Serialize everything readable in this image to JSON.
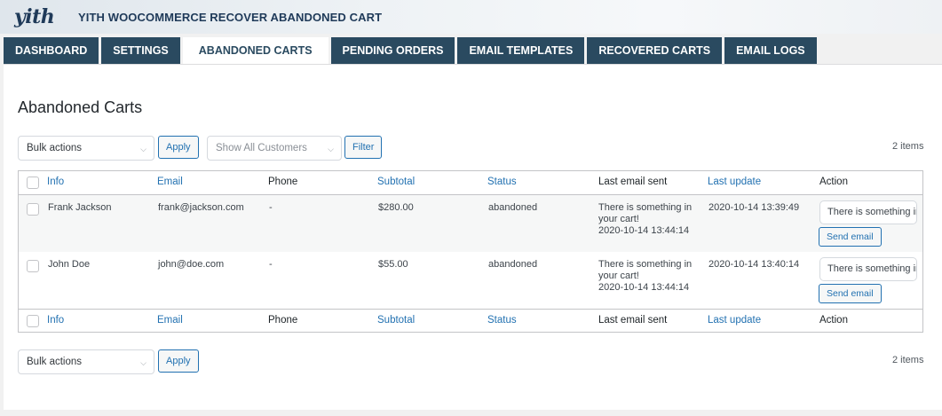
{
  "banner": {
    "logo": "yith",
    "title": "YITH WOOCOMMERCE RECOVER ABANDONED CART"
  },
  "tabs": [
    {
      "label": "DASHBOARD",
      "active": false
    },
    {
      "label": "SETTINGS",
      "active": false
    },
    {
      "label": "ABANDONED CARTS",
      "active": true
    },
    {
      "label": "PENDING ORDERS",
      "active": false
    },
    {
      "label": "EMAIL TEMPLATES",
      "active": false
    },
    {
      "label": "RECOVERED CARTS",
      "active": false
    },
    {
      "label": "EMAIL LOGS",
      "active": false
    }
  ],
  "page": {
    "title": "Abandoned Carts"
  },
  "top_controls": {
    "bulk_actions": "Bulk actions",
    "apply": "Apply",
    "customer_filter": "Show All Customers",
    "filter": "Filter",
    "items_count": "2 items"
  },
  "bottom_controls": {
    "bulk_actions": "Bulk actions",
    "apply": "Apply",
    "items_count": "2 items"
  },
  "table": {
    "columns": {
      "info": "Info",
      "email": "Email",
      "phone": "Phone",
      "subtotal": "Subtotal",
      "status": "Status",
      "last_email_sent": "Last email sent",
      "last_update": "Last update",
      "action": "Action"
    },
    "rows": [
      {
        "info": "Frank Jackson",
        "email": "frank@jackson.com",
        "phone": "-",
        "subtotal": "$280.00",
        "status": "abandoned",
        "last_email_line1": "There is something in",
        "last_email_line2": "your cart!",
        "last_email_date": "2020-10-14 13:44:14",
        "last_update": "2020-10-14 13:39:49",
        "action_text": "There is something in your cart!",
        "send_label": "Send email"
      },
      {
        "info": "John Doe",
        "email": "john@doe.com",
        "phone": "-",
        "subtotal": "$55.00",
        "status": "abandoned",
        "last_email_line1": "There is something in",
        "last_email_line2": "your cart!",
        "last_email_date": "2020-10-14 13:44:14",
        "last_update": "2020-10-14 13:40:14",
        "action_text": "There is something in your cart!",
        "send_label": "Send email"
      }
    ]
  },
  "colors": {
    "tab_bg": "#2a4a60",
    "link": "#2271b1",
    "brand": "#1f3a59"
  },
  "icons": {
    "select_chevron": "chevron-down-icon"
  }
}
